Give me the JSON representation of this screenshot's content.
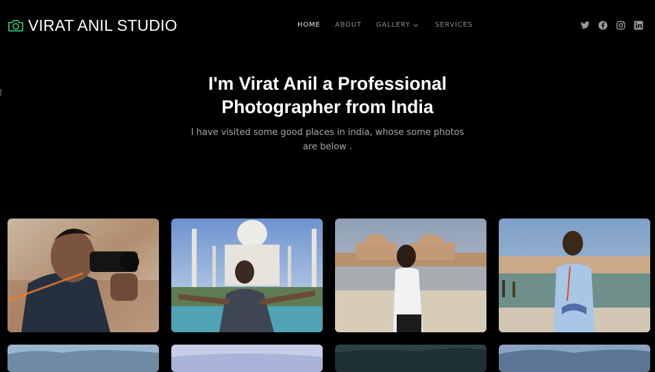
{
  "brand": {
    "name": "VIRAT ANIL STUDIO",
    "icon": "camera-icon",
    "accent_color": "#2fbf71"
  },
  "nav": {
    "items": [
      {
        "label": "HOME",
        "active": true
      },
      {
        "label": "ABOUT",
        "active": false
      },
      {
        "label": "GALLERY",
        "active": false,
        "has_dropdown": true
      },
      {
        "label": "SERVICES",
        "active": false
      }
    ]
  },
  "socials": [
    "twitter-icon",
    "facebook-icon",
    "instagram-icon",
    "linkedin-icon"
  ],
  "hero": {
    "title": "I'm Virat Anil a Professional Photographer from India",
    "subtitle": "I have visited some good places in india, whose some photos are below ."
  },
  "gallery": {
    "photos": [
      "photographer-with-camera",
      "taj-mahal-portrait",
      "monument-courtyard-portrait",
      "riverside-ghat-portrait",
      "mountain-landscape",
      "sky-landscape",
      "forest-landscape",
      "hills-landscape"
    ]
  }
}
